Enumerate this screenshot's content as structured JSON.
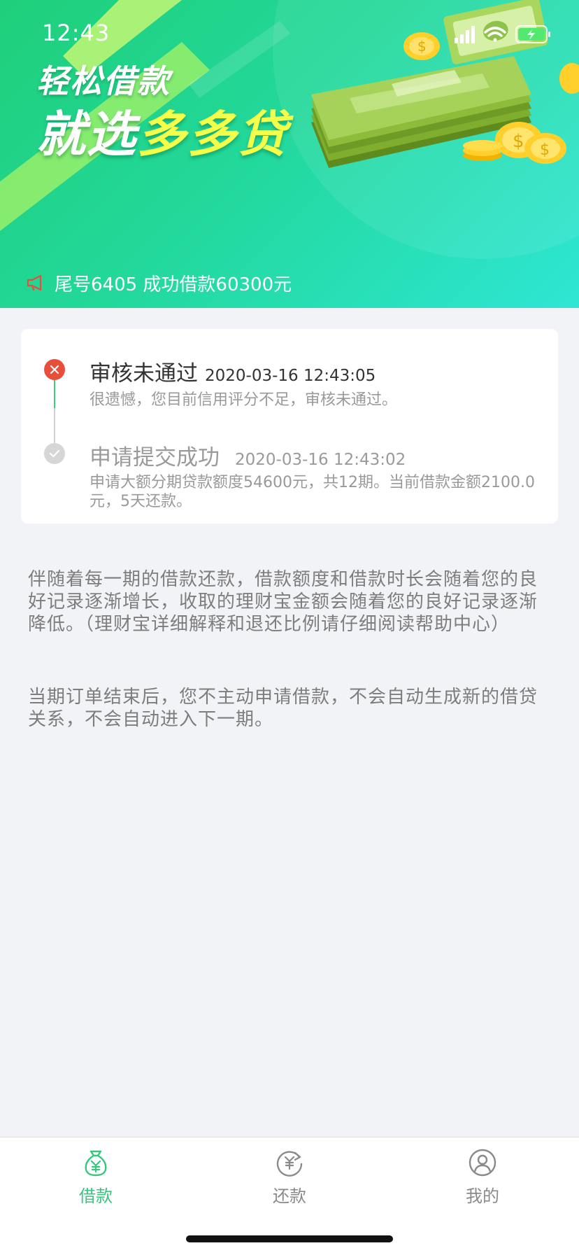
{
  "status_bar": {
    "time": "12:43"
  },
  "banner": {
    "headline_line1": "轻松借款",
    "headline_line2_prefix": "就选",
    "headline_line2_brand": "多多贷",
    "notice": "尾号6405 成功借款60300元"
  },
  "timeline": [
    {
      "title": "审核未通过",
      "time": "2020-03-16 12:43:05",
      "description": "很遗憾，您目前信用评分不足，审核未通过。",
      "status": "failed"
    },
    {
      "title": "申请提交成功",
      "time": "2020-03-16 12:43:02",
      "description": "申请大额分期贷款额度54600元，共12期。当前借款金额2100.0元，5天还款。",
      "status": "done"
    }
  ],
  "info": {
    "paragraph1": "伴随着每一期的借款还款，借款额度和借款时长会随着您的良好记录逐渐增长，收取的理财宝金额会随着您的良好记录逐渐降低。（理财宝详细解释和退还比例请仔细阅读帮助中心）",
    "paragraph2": "当期订单结束后，您不主动申请借款，不会自动生成新的借贷关系，不会自动进入下一期。"
  },
  "tabs": [
    {
      "label": "借款",
      "icon": "money-bag-icon",
      "active": true
    },
    {
      "label": "还款",
      "icon": "repay-cycle-icon",
      "active": false
    },
    {
      "label": "我的",
      "icon": "user-profile-icon",
      "active": false
    }
  ],
  "colors": {
    "accent_green": "#35c77c",
    "fail_red": "#e84f3a",
    "brand_yellow": "#f4ff4a"
  }
}
